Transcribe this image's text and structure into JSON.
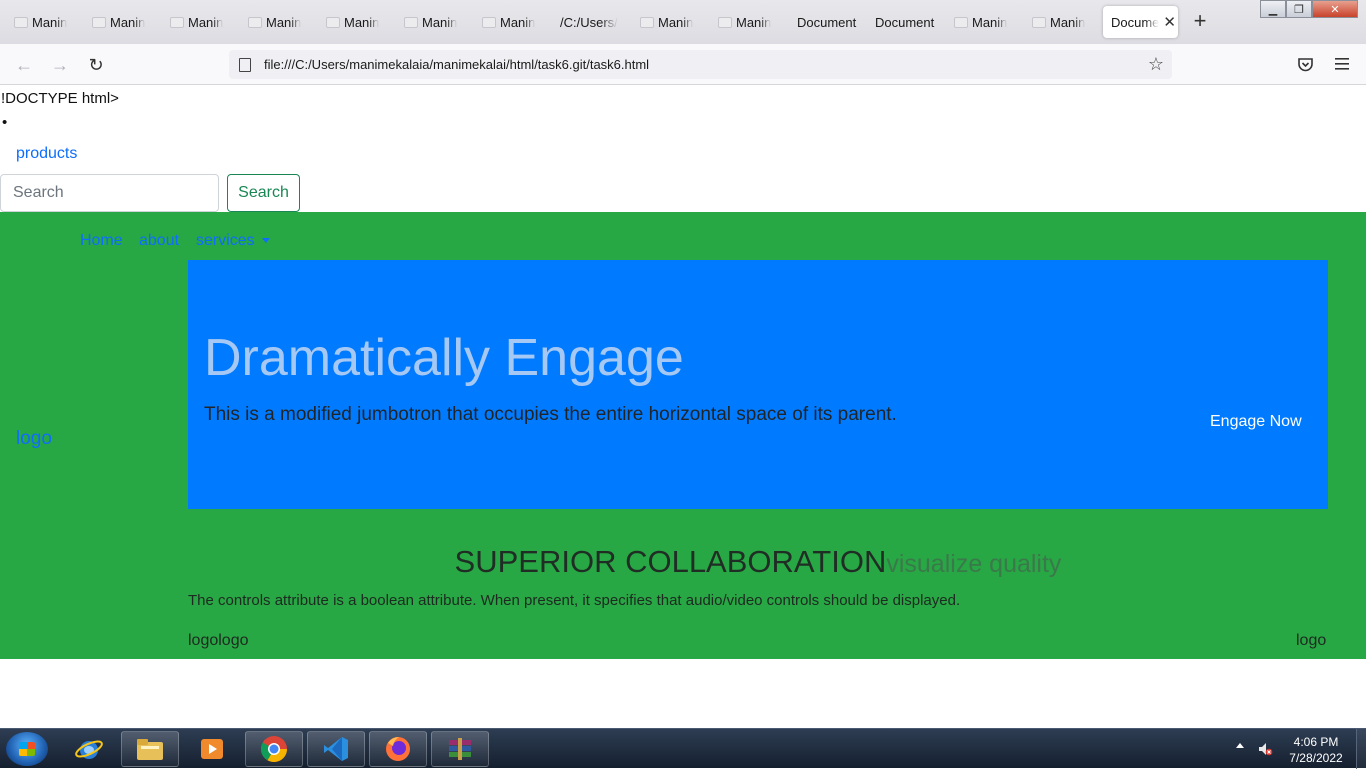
{
  "browser": {
    "tabs": [
      {
        "label": "Manin"
      },
      {
        "label": "Manin"
      },
      {
        "label": "Manin"
      },
      {
        "label": "Manin"
      },
      {
        "label": "Manin"
      },
      {
        "label": "Manin"
      },
      {
        "label": "Manin"
      },
      {
        "label": "/C:/Users/"
      },
      {
        "label": "Manin"
      },
      {
        "label": "Manin"
      },
      {
        "label": "Document"
      },
      {
        "label": "Document"
      },
      {
        "label": "Manin"
      },
      {
        "label": "Manin"
      },
      {
        "label": "Docume"
      }
    ],
    "active_tab_index": 14,
    "url": "file:///C:/Users/manimekalaia/manimekalai/html/task6.git/task6.html"
  },
  "page": {
    "doctype_text": "!DOCTYPE html>",
    "bullet": "•",
    "products_link": "products",
    "search": {
      "placeholder": "Search",
      "value": "",
      "button_label": "Search"
    },
    "nav": {
      "home": "Home",
      "about": "about",
      "services": "services"
    },
    "logo_left": "logo",
    "jumbotron": {
      "title": "Dramatically Engage",
      "lead": "This is a modified jumbotron that occupies the entire horizontal space of its parent.",
      "cta": "Engage Now"
    },
    "collab": {
      "title": "SUPERIOR COLLABORATION",
      "subtitle": "visualize quality"
    },
    "controls_text": "The controls attribute is a boolean attribute. When present, it specifies that audio/video controls should be displayed.",
    "footer": {
      "left": "logologo",
      "right": "logo"
    }
  },
  "taskbar": {
    "icons": [
      "start-orb",
      "internet-explorer-icon",
      "file-explorer-icon",
      "media-player-icon",
      "chrome-icon",
      "vscode-icon",
      "firefox-icon",
      "winrar-icon"
    ],
    "time": "4:06 PM",
    "date": "7/28/2022"
  },
  "colors": {
    "green_section": "#28a745",
    "jumbotron_bg": "#007bff",
    "link": "#0d6efd",
    "search_button": "#198754"
  }
}
